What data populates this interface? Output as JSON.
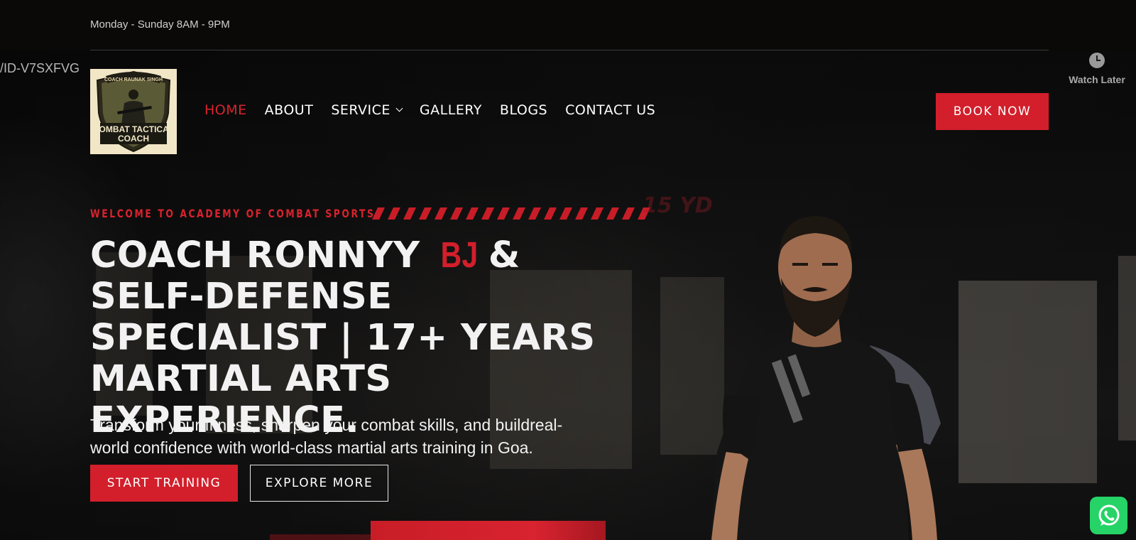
{
  "topbar": {
    "hours": "Monday - Sunday 8AM - 9PM"
  },
  "overlay": {
    "video_id_fragment": "/ID-V7SXFVG",
    "watch_later_label": "Watch Later"
  },
  "logo": {
    "top_text": "COACH RAUNAK SINGH",
    "main_text_line1": "COMBAT TACTICAL",
    "main_text_line2": "COACH"
  },
  "nav": {
    "items": [
      {
        "label": "HOME",
        "active": true
      },
      {
        "label": "ABOUT",
        "active": false
      },
      {
        "label": "SERVICE",
        "active": false,
        "has_dropdown": true
      },
      {
        "label": "GALLERY",
        "active": false
      },
      {
        "label": "BLOGS",
        "active": false
      },
      {
        "label": "CONTACT US",
        "active": false
      }
    ],
    "book_now": "BOOK NOW"
  },
  "hero": {
    "eyebrow": "WELCOME TO ACADEMY OF COMBAT SPORTS",
    "headline_part1": "COACH RONNYY",
    "headline_accent": "BJ",
    "headline_part2": "& SELF-DEFENSE SPECIALIST | 17+ YEARS MARTIAL ARTS EXPERIENCE.",
    "subtext": "Transform your fitness, sharpen your combat skills, and buildreal-world confidence with world-class martial arts training in Goa.",
    "primary_cta": "START TRAINING",
    "secondary_cta": "EXPLORE MORE",
    "ghost_mark": "15 YD"
  },
  "colors": {
    "accent": "#d21f2b",
    "background": "#0d0d0d",
    "whatsapp": "#25d366",
    "logo_bg": "#f1e6c6"
  },
  "icons": {
    "watch_later": "clock-icon",
    "service_dropdown": "chevron-down-icon",
    "whatsapp": "whatsapp-icon"
  }
}
